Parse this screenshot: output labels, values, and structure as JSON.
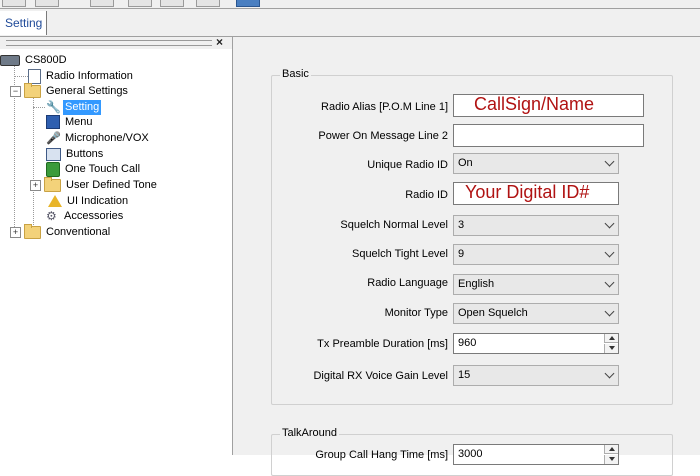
{
  "tabs": [
    {
      "label": "Setting"
    }
  ],
  "tree": {
    "root": "CS800D",
    "items": {
      "radio_information": "Radio Information",
      "general_settings": "General Settings",
      "setting": "Setting",
      "menu": "Menu",
      "microphone_vox": "Microphone/VOX",
      "buttons": "Buttons",
      "one_touch_call": "One Touch Call",
      "user_defined_tone": "User Defined Tone",
      "ui_indication": "UI Indication",
      "accessories": "Accessories",
      "conventional": "Conventional"
    },
    "expander_collapsed": "+",
    "expander_expanded": "−",
    "close_glyph": "×"
  },
  "basic": {
    "title": "Basic",
    "fields": {
      "radio_alias": {
        "label": "Radio Alias [P.O.M Line 1]",
        "value": "CallSign/Name"
      },
      "power_on_message_line2": {
        "label": "Power On Message Line 2",
        "value": ""
      },
      "unique_radio_id": {
        "label": "Unique Radio ID",
        "value": "On"
      },
      "radio_id": {
        "label": "Radio ID",
        "value": "Your Digital ID#"
      },
      "squelch_normal_level": {
        "label": "Squelch Normal Level",
        "value": "3"
      },
      "squelch_tight_level": {
        "label": "Squelch Tight Level",
        "value": "9"
      },
      "radio_language": {
        "label": "Radio Language",
        "value": "English"
      },
      "monitor_type": {
        "label": "Monitor Type",
        "value": "Open Squelch"
      },
      "tx_preamble_duration": {
        "label": "Tx Preamble Duration [ms]",
        "value": "960"
      },
      "digital_rx_voice_gain": {
        "label": "Digital RX Voice Gain Level",
        "value": "15"
      }
    }
  },
  "talkaround": {
    "title": "TalkAround",
    "fields": {
      "group_call_hang_time": {
        "label": "Group Call Hang Time [ms]",
        "value": "3000"
      }
    }
  },
  "colors": {
    "selection": "#3399ff",
    "overlay_text": "#b01212",
    "tab_text": "#1f4a99"
  }
}
